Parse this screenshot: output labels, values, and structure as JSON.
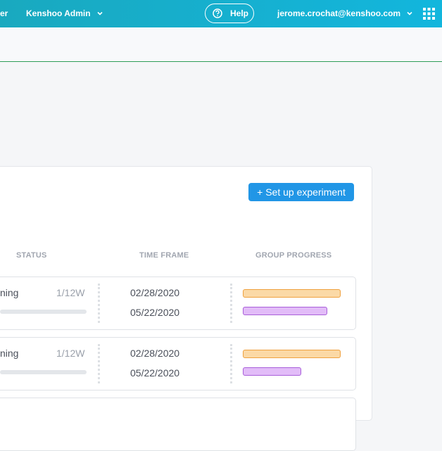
{
  "topbar": {
    "partial_left": "er",
    "account": "Kenshoo Admin",
    "help": "Help",
    "user_email": "jerome.crochat@kenshoo.com"
  },
  "card": {
    "setup_button": "+ Set up experiment",
    "columns": [
      "STATUS",
      "TIME FRAME",
      "GROUP PROGRESS"
    ],
    "rows": [
      {
        "status": "ning",
        "weeks": "1/12W",
        "start": "02/28/2020",
        "end": "05/22/2020",
        "orange_fill": 1.0,
        "purple_fill": 0.86
      },
      {
        "status": "ning",
        "weeks": "1/12W",
        "start": "02/28/2020",
        "end": "05/22/2020",
        "orange_fill": 1.0,
        "purple_fill": 0.6
      }
    ]
  },
  "colors": {
    "topbar": "#16b0d0",
    "button": "#2196e6",
    "orange": "#fbd9a6",
    "purple": "#e2bcf8"
  }
}
